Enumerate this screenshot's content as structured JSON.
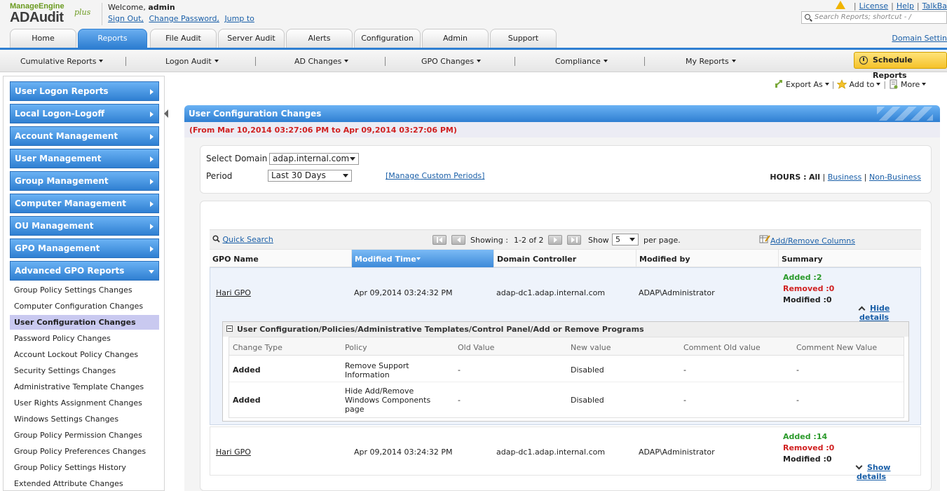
{
  "header": {
    "logo_brand": "ManageEngine",
    "logo_app": "ADAudit",
    "logo_plus": "plus",
    "welcome_prefix": "Welcome,",
    "username": "admin",
    "links": [
      "Sign Out,",
      "Change Password,",
      "Jump to"
    ],
    "top_links": [
      "License",
      "Help",
      "TalkBa"
    ],
    "search_placeholder": "Search Reports; shortcut - /",
    "domain_settings": "Domain Settin"
  },
  "tabs": [
    "Home",
    "Reports",
    "File Audit",
    "Server Audit",
    "Alerts",
    "Configuration",
    "Admin",
    "Support"
  ],
  "active_tab": "Reports",
  "subnav": [
    "Cumulative Reports",
    "Logon Audit",
    "AD Changes",
    "GPO Changes",
    "Compliance",
    "My Reports"
  ],
  "schedule_button": "Schedule Reports",
  "sidebar": {
    "sections": [
      "User Logon Reports",
      "Local Logon-Logoff",
      "Account Management",
      "User Management",
      "Group Management",
      "Computer Management",
      "OU Management",
      "GPO Management",
      "Advanced GPO Reports"
    ],
    "items": [
      "Group Policy Settings Changes",
      "Computer Configuration Changes",
      "User Configuration Changes",
      "Password Policy Changes",
      "Account Lockout Policy Changes",
      "Security Settings Changes",
      "Administrative Template Changes",
      "User Rights Assignment Changes",
      "Windows Settings Changes",
      "Group Policy Permission Changes",
      "Group Policy Preferences Changes",
      "Group Policy Settings History",
      "Extended Attribute Changes"
    ],
    "selected_item": "User Configuration Changes"
  },
  "actions": {
    "export": "Export As",
    "add_to": "Add to",
    "more": "More"
  },
  "report": {
    "title": "User Configuration Changes",
    "range": "(From Mar 10,2014 03:27:06 PM to Apr 09,2014 03:27:06 PM)",
    "domain_label": "Select Domain",
    "domain_value": "adap.internal.com",
    "period_label": "Period",
    "period_value": "Last 30 Days",
    "manage_periods": "[Manage Custom Periods]",
    "hours_label": "HOURS :",
    "hours_all": "All",
    "hours_business": "Business",
    "hours_nonbusiness": "Non-Business"
  },
  "toolbar": {
    "quick_search": "Quick Search",
    "showing_label": "Showing :",
    "showing_range": "1-2 of 2",
    "show_label": "Show",
    "page_size": "5",
    "per_page": "per page.",
    "add_remove_columns": "Add/Remove Columns"
  },
  "columns": [
    "GPO Name",
    "Modified Time",
    "Domain Controller",
    "Modified by",
    "Summary"
  ],
  "sorted_column": "Modified Time",
  "rows": [
    {
      "gpo": "Hari GPO",
      "time": "Apr 09,2014 03:24:32 PM",
      "dc": "adap-dc1.adap.internal.com",
      "by": "ADAP\\Administrator",
      "added": "Added :2",
      "removed": "Removed :0",
      "modified": "Modified :0",
      "toggle": "Hide details"
    },
    {
      "gpo": "Hari GPO",
      "time": "Apr 09,2014 03:24:32 PM",
      "dc": "adap-dc1.adap.internal.com",
      "by": "ADAP\\Administrator",
      "added": "Added :14",
      "removed": "Removed :0",
      "modified": "Modified :0",
      "toggle": "Show details"
    }
  ],
  "detail": {
    "path": "User Configuration/Policies/Administrative Templates/Control Panel/Add or Remove Programs",
    "columns": [
      "Change Type",
      "Policy",
      "Old Value",
      "New value",
      "Comment Old value",
      "Comment New Value"
    ],
    "rows": [
      {
        "type": "Added",
        "policy": "Remove Support Information",
        "old": "-",
        "new": "Disabled",
        "c_old": "-",
        "c_new": "-"
      },
      {
        "type": "Added",
        "policy": "Hide Add/Remove Windows Components page",
        "old": "-",
        "new": "Disabled",
        "c_old": "-",
        "c_new": "-"
      }
    ]
  },
  "colors": {
    "accent_blue": "#2f7fd2",
    "added_green": "#2a9a2a",
    "removed_red": "#d02020",
    "schedule_yellow": "#f5c22a"
  }
}
